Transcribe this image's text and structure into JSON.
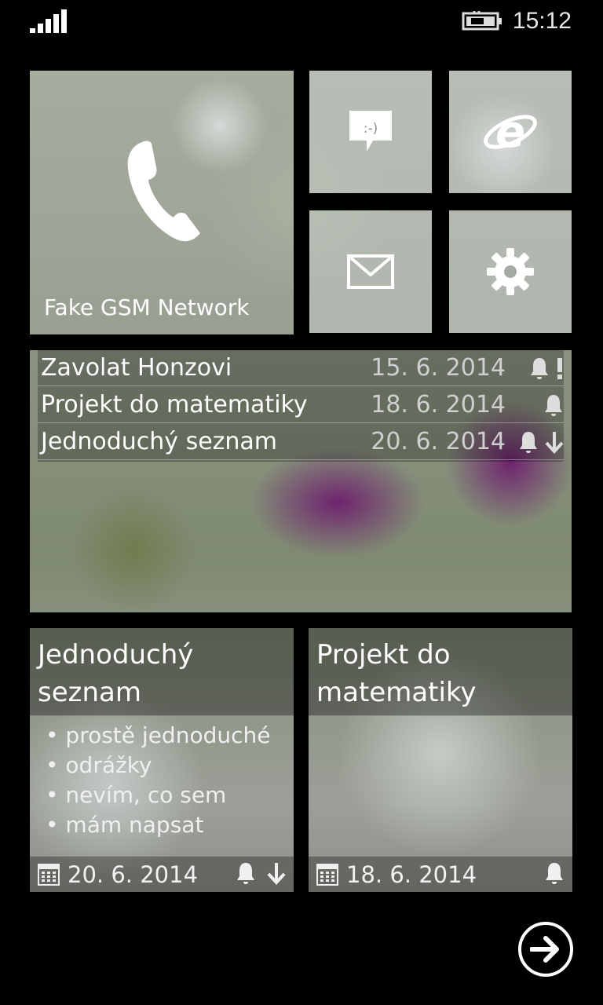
{
  "status_bar": {
    "time": "15:12",
    "signal_icon": "signal-bars-icon",
    "battery_icon": "battery-charging-icon"
  },
  "tiles": {
    "phone": {
      "label": "Fake GSM Network",
      "icon": "phone-handset-icon"
    },
    "messaging": {
      "icon": "messaging-smiley-icon"
    },
    "internet_explorer": {
      "icon": "internet-explorer-icon"
    },
    "mail": {
      "icon": "envelope-icon"
    },
    "settings": {
      "icon": "gear-icon"
    }
  },
  "task_list": [
    {
      "title": "Zavolat Honzovi",
      "date": "15. 6. 2014",
      "reminder": true,
      "priority": "high"
    },
    {
      "title": "Projekt do matematiky",
      "date": "18. 6. 2014",
      "reminder": true,
      "priority": "normal"
    },
    {
      "title": "Jednoduchý seznam",
      "date": "20. 6. 2014",
      "reminder": true,
      "priority": "low"
    }
  ],
  "notes": [
    {
      "title": "Jednoduchý seznam",
      "items": [
        "prostě jednoduché",
        "odrážky",
        "nevím, co sem",
        "mám napsat"
      ],
      "date": "20. 6. 2014",
      "reminder": true,
      "priority": "low"
    },
    {
      "title": "Projekt do matematiky",
      "items": [],
      "date": "18. 6. 2014",
      "reminder": true,
      "priority": "normal"
    }
  ],
  "navigation": {
    "next_icon": "arrow-right-circle-icon"
  },
  "colors": {
    "background": "#000000",
    "text": "#ffffff",
    "accent_berry": "#6e1e6e"
  }
}
